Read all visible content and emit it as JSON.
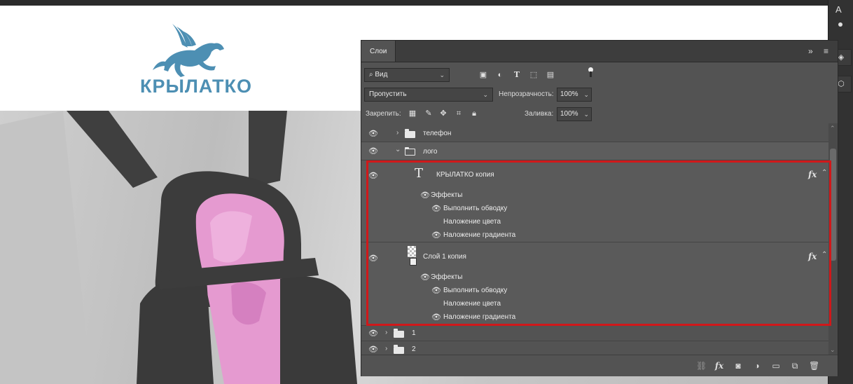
{
  "logo": {
    "text": "КРЫЛАТКО"
  },
  "panel": {
    "tab_label": "Слои",
    "filter_label": "Вид",
    "blend_mode": "Пропустить",
    "opacity_label": "Непрозрачность:",
    "opacity_value": "100%",
    "lock_label": "Закрепить:",
    "fill_label": "Заливка:",
    "fill_value": "100%"
  },
  "layers": {
    "phone": {
      "name": "телефон"
    },
    "logo_group": {
      "name": "лого"
    },
    "text_layer": {
      "name": "КРЫЛАТКО копия",
      "effects_label": "Эффекты",
      "effects": [
        "Выполнить обводку",
        "Наложение цвета",
        "Наложение градиента"
      ]
    },
    "layer1": {
      "name": "Слой 1 копия",
      "effects_label": "Эффекты",
      "effects": [
        "Выполнить обводку",
        "Наложение цвета",
        "Наложение градиента"
      ]
    },
    "group1": {
      "name": "1"
    },
    "group2": {
      "name": "2"
    }
  },
  "icons": {
    "fx": "fx",
    "type_tool": "T"
  },
  "colors": {
    "highlight": "#d0181a",
    "logo_blue": "#4d8fb3",
    "panel_bg": "#535353"
  }
}
